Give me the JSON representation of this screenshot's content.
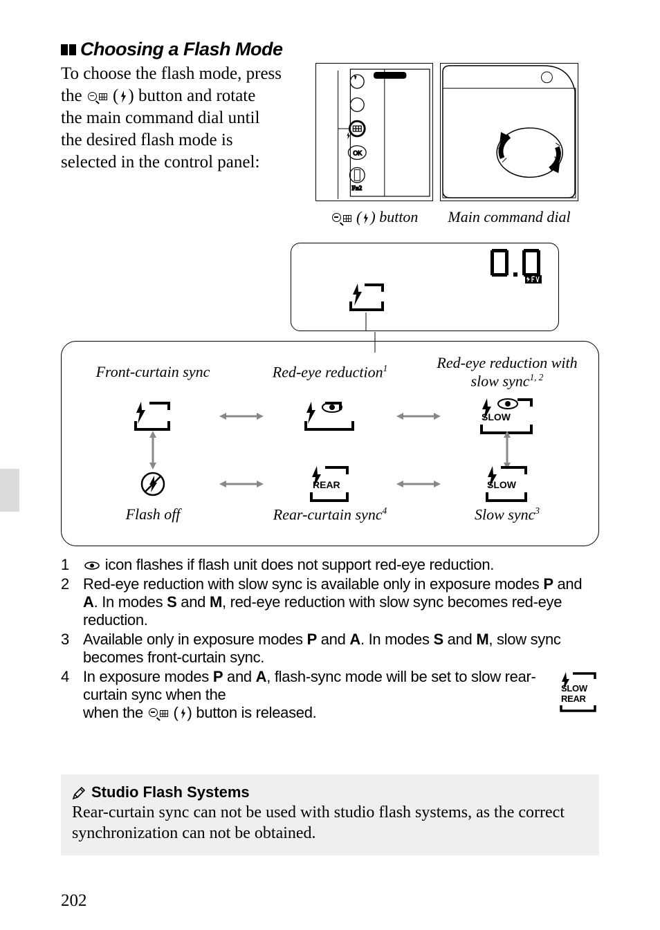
{
  "heading": "Choosing a Flash Mode",
  "intro": {
    "line1": "To choose the flash mode, press",
    "line2a": "the ",
    "line2b": " (",
    "line2c": ") button and rotate",
    "line3": "the main command dial until",
    "line4": "the desired flash mode is",
    "line5": "selected in the control panel:"
  },
  "captions": {
    "button": " button",
    "dial": "Main command dial"
  },
  "panel": {
    "digits": "0.0"
  },
  "modes": {
    "frontCurtain": "Front-curtain sync",
    "redEye": "Red-eye reduction",
    "redEyeSup": "1",
    "redEyeSlow": "Red-eye reduction with slow sync",
    "redEyeSlowSup": "1, 2",
    "flashOff": "Flash off",
    "rearCurtain": "Rear-curtain sync",
    "rearCurtainSup": "4",
    "slowSync": "Slow sync",
    "slowSyncSup": "3",
    "labels": {
      "slow": "SLOW",
      "rear": "REAR"
    }
  },
  "footnotes": {
    "1": " icon flashes if flash unit does not support red-eye reduction.",
    "2a": "Red-eye reduction with slow sync is available only in exposure modes ",
    "2b": " and ",
    "2c": ".  In modes ",
    "2d": " and ",
    "2e": ", red-eye reduction with slow sync becomes red-eye reduction.",
    "3a": "Available only in exposure modes ",
    "3b": " and ",
    "3c": ".  In modes ",
    "3d": " and ",
    "3e": ", slow sync becomes front-curtain sync.",
    "4a": "In exposure modes ",
    "4b": " and ",
    "4c": ", flash-sync mode will be set to slow rear-curtain sync when the ",
    "4d": " (",
    "4e": ") button is released.",
    "modes": {
      "P": "P",
      "A": "A",
      "S": "S",
      "M": "M"
    }
  },
  "noteBox": {
    "title": "Studio Flash Systems",
    "body": "Rear-curtain sync can not be used with studio flash systems, as the correct synchronization can not be obtained."
  },
  "pageNumber": "202"
}
